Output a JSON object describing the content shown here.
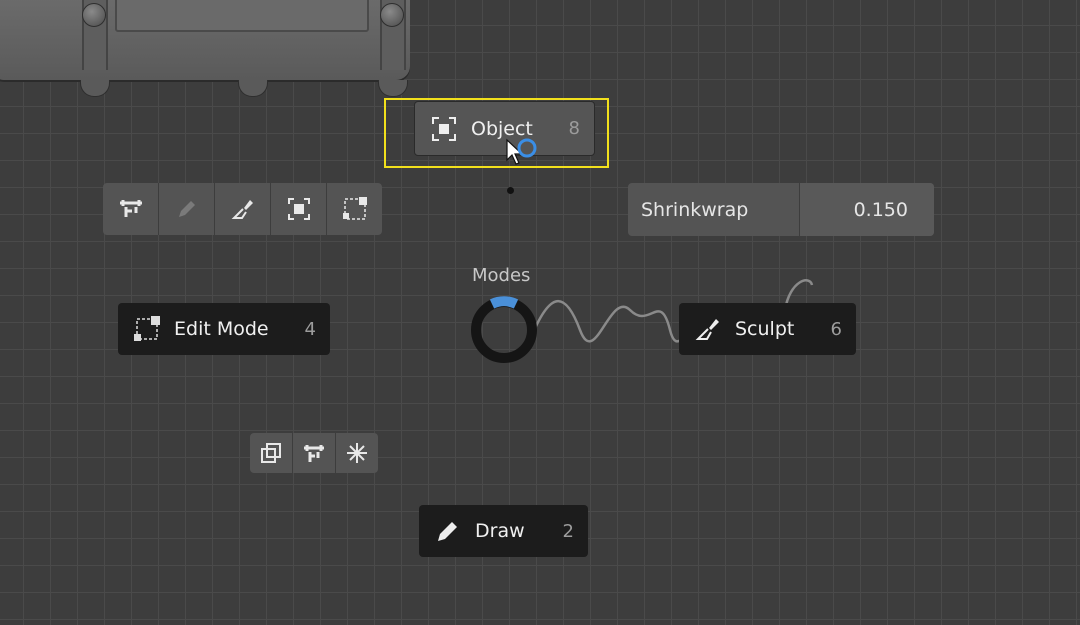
{
  "pie": {
    "title": "Modes",
    "items": [
      {
        "label": "Object",
        "number": "8",
        "icon": "object-mode-icon"
      },
      {
        "label": "Edit Mode",
        "number": "4",
        "icon": "edit-mode-icon"
      },
      {
        "label": "Sculpt",
        "number": "6",
        "icon": "sculpt-icon"
      },
      {
        "label": "Draw",
        "number": "2",
        "icon": "draw-icon"
      }
    ]
  },
  "shrinkwrap": {
    "label": "Shrinkwrap",
    "value": "0.150"
  },
  "colors": {
    "highlight": "#f2e01c",
    "accent": "#4a90d9",
    "cursor_ring": "#3a8ee6"
  }
}
